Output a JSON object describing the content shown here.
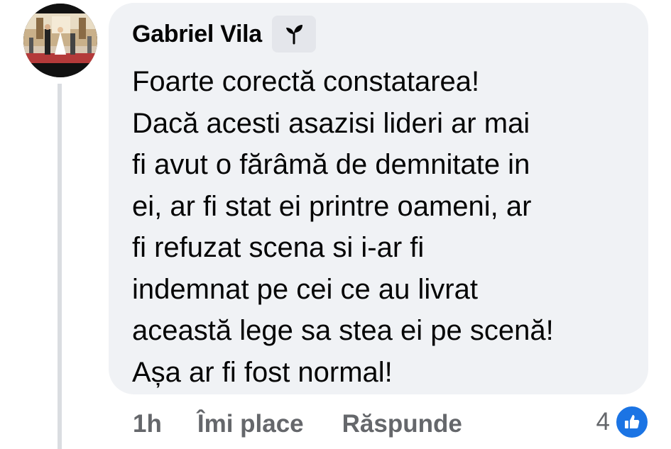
{
  "comment": {
    "author": "Gabriel Vila",
    "author_badge_icon": "sprout-icon",
    "lines": [
      "Foarte corectă constatarea!",
      "Dacă acesti asazisi lideri ar mai",
      "fi avut o fărâmă de demnitate in",
      "ei, ar fi stat ei printre oameni, ar",
      "fi refuzat scena si i-ar fi",
      "indemnat pe cei ce au livrat",
      "această lege sa stea ei pe scenă!",
      "Așa ar fi fost normal!"
    ]
  },
  "actions": {
    "timestamp": "1h",
    "like_label": "Îmi place",
    "reply_label": "Răspunde"
  },
  "reactions": {
    "count": "4",
    "icon": "thumbs-up-icon",
    "color": "#1b74e4"
  },
  "colors": {
    "bubble": "#f0f2f5",
    "text": "#050505",
    "secondary_text": "#65676b"
  }
}
